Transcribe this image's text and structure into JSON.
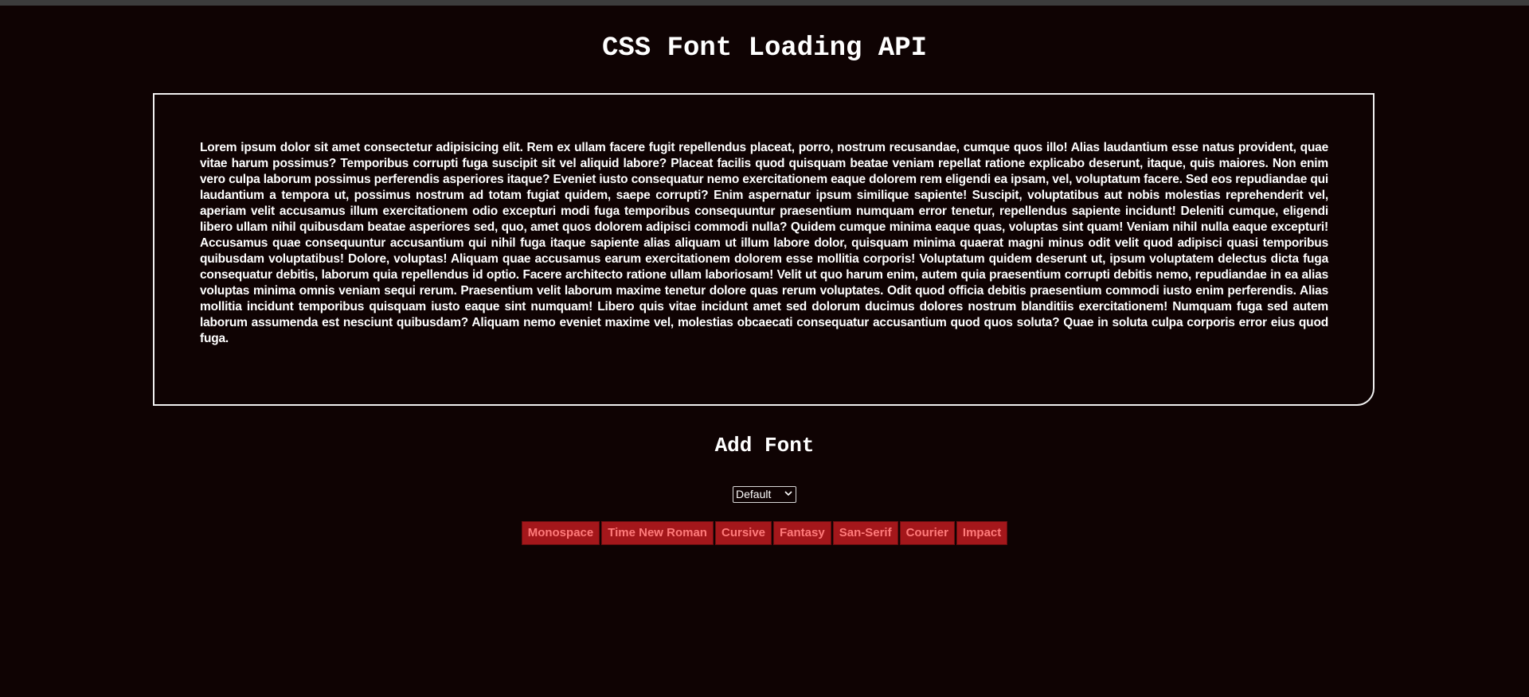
{
  "page": {
    "title": "CSS Font Loading API"
  },
  "panel": {
    "text": "Lorem ipsum dolor sit amet consectetur adipisicing elit. Rem ex ullam facere fugit repellendus placeat, porro, nostrum recusandae, cumque quos illo! Alias laudantium esse natus provident, quae vitae harum possimus? Temporibus corrupti fuga suscipit sit vel aliquid labore? Placeat facilis quod quisquam beatae veniam repellat ratione explicabo deserunt, itaque, quis maiores. Non enim vero culpa laborum possimus perferendis asperiores itaque? Eveniet iusto consequatur nemo exercitationem eaque dolorem rem eligendi ea ipsam, vel, voluptatum facere. Sed eos repudiandae qui laudantium a tempora ut, possimus nostrum ad totam fugiat quidem, saepe corrupti? Enim aspernatur ipsum similique sapiente! Suscipit, voluptatibus aut nobis molestias reprehenderit vel, aperiam velit accusamus illum exercitationem odio excepturi modi fuga temporibus consequuntur praesentium numquam error tenetur, repellendus sapiente incidunt! Deleniti cumque, eligendi libero ullam nihil quibusdam beatae asperiores sed, quo, amet quos dolorem adipisci commodi nulla? Quidem cumque minima eaque quas, voluptas sint quam! Veniam nihil nulla eaque excepturi! Accusamus quae consequuntur accusantium qui nihil fuga itaque sapiente alias aliquam ut illum labore dolor, quisquam minima quaerat magni minus odit velit quod adipisci quasi temporibus quibusdam voluptatibus! Dolore, voluptas! Aliquam quae accusamus earum exercitationem dolorem esse mollitia corporis! Voluptatum quidem deserunt ut, ipsum voluptatem delectus dicta fuga consequatur debitis, laborum quia repellendus id optio. Facere architecto ratione ullam laboriosam! Velit ut quo harum enim, autem quia praesentium corrupti debitis nemo, repudiandae in ea alias voluptas minima omnis veniam sequi rerum. Praesentium velit laborum maxime tenetur dolore quas rerum voluptates. Odit quod officia debitis praesentium commodi iusto enim perferendis. Alias mollitia incidunt temporibus quisquam iusto eaque sint numquam! Libero quis vitae incidunt amet sed dolorum ducimus dolores nostrum blanditiis exercitationem! Numquam fuga sed autem laborum assumenda est nesciunt quibusdam? Aliquam nemo eveniet maxime vel, molestias obcaecati consequatur accusantium quod quos soluta? Quae in soluta culpa corporis error eius quod fuga."
  },
  "add_font": {
    "title": "Add Font",
    "select_value": "Default",
    "select_icon": "chevron-down-icon",
    "buttons": [
      {
        "label": "Monospace"
      },
      {
        "label": "Time New Roman"
      },
      {
        "label": "Cursive"
      },
      {
        "label": "Fantasy"
      },
      {
        "label": "San-Serif"
      },
      {
        "label": "Courier"
      },
      {
        "label": "Impact"
      }
    ]
  },
  "colors": {
    "background": "#0f0303",
    "text": "#ffffff",
    "button_background": "#a4171b",
    "button_text": "#ff7a7a"
  }
}
